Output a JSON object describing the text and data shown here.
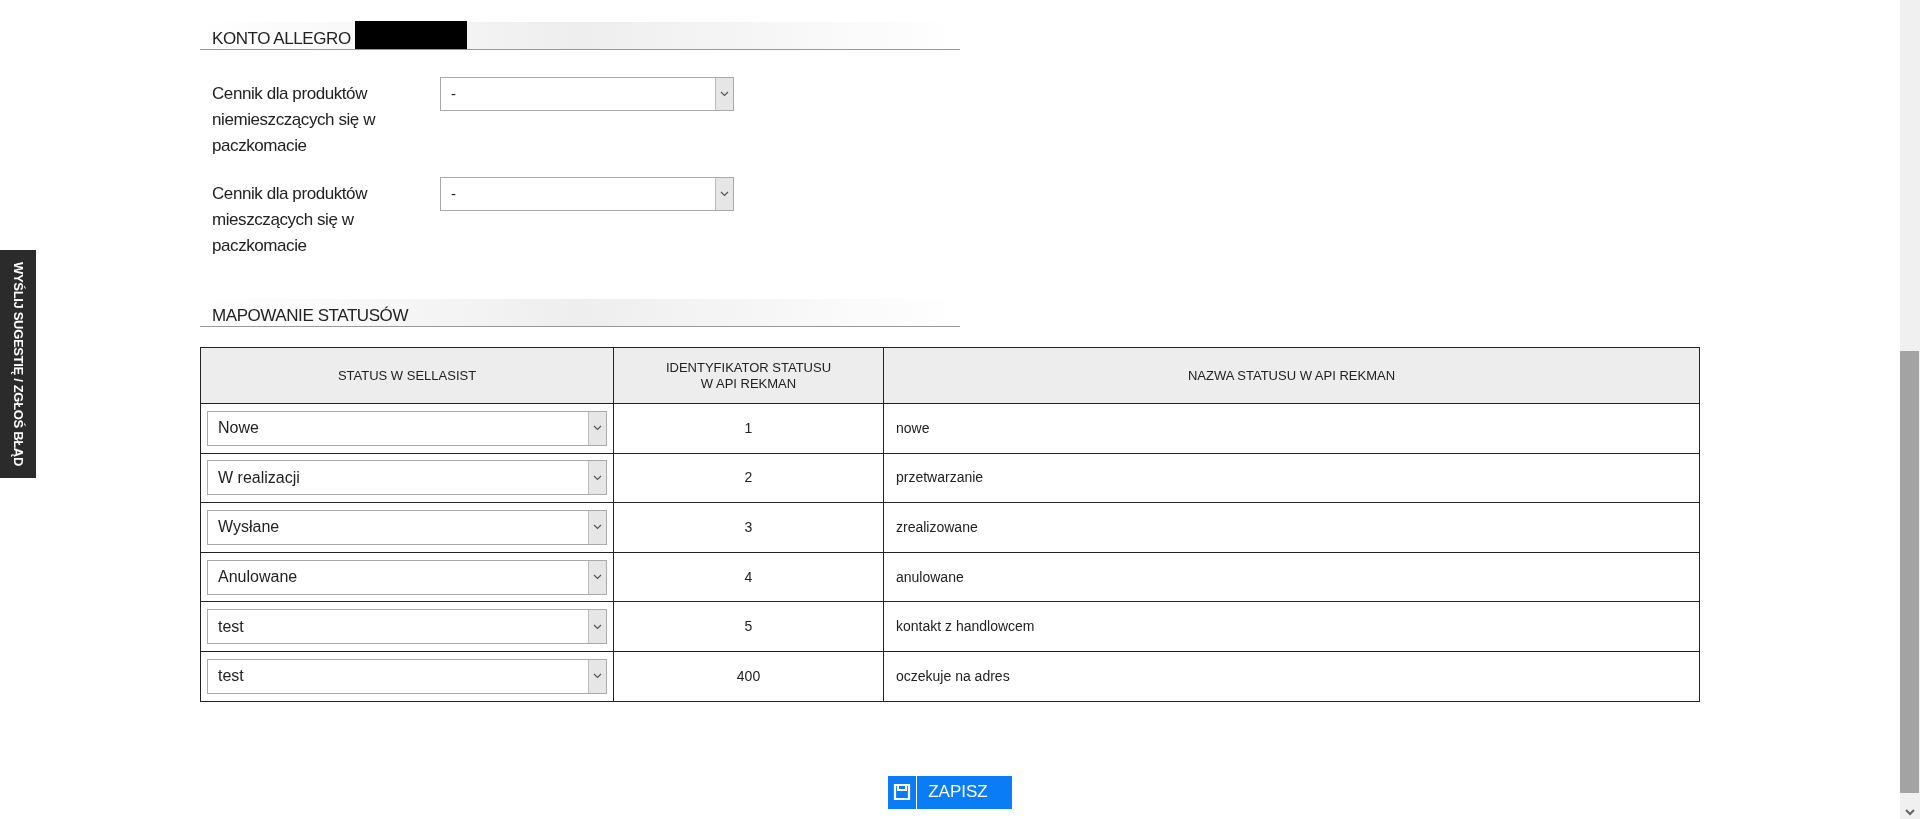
{
  "side_tab": {
    "label": "WYŚLIJ SUGESTIĘ / ZGŁOŚ BŁĄD"
  },
  "sections": [
    {
      "title": "KONTO ALLEGRO",
      "redacted": true,
      "fields": [
        {
          "label": "Cennik dla produktów niemieszczących się w paczkomacie",
          "value": "-"
        },
        {
          "label": "Cennik dla produktów mieszczących się w paczkomacie",
          "value": "-"
        }
      ]
    },
    {
      "title": "MAPOWANIE STATUSÓW",
      "redacted": false
    }
  ],
  "table": {
    "columns": [
      "STATUS W SELLASIST",
      "IDENTYFIKATOR STATUSU\nW API REKMAN",
      "NAZWA STATUSU W API REKMAN"
    ],
    "rows": [
      {
        "status": "Nowe",
        "id": "1",
        "name": "nowe"
      },
      {
        "status": "W realizacji",
        "id": "2",
        "name": "przetwarzanie"
      },
      {
        "status": "Wysłane",
        "id": "3",
        "name": "zrealizowane"
      },
      {
        "status": "Anulowane",
        "id": "4",
        "name": "anulowane"
      },
      {
        "status": "test",
        "id": "5",
        "name": "kontakt z handlowcem"
      },
      {
        "status": "test",
        "id": "400",
        "name": "oczekuje na adres"
      }
    ]
  },
  "save_button": {
    "label": "ZAPISZ"
  }
}
